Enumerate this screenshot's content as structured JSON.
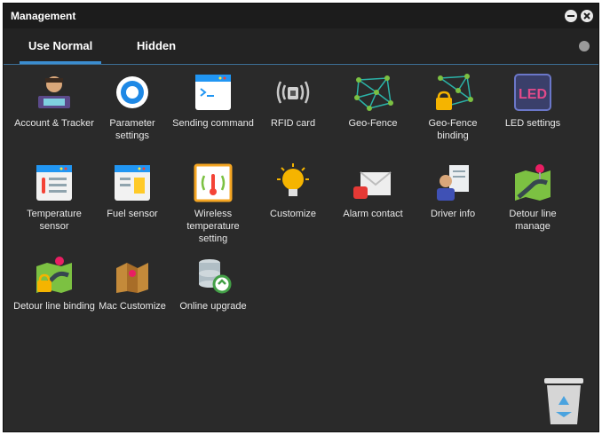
{
  "window": {
    "title": "Management"
  },
  "tabs": [
    {
      "label": "Use Normal",
      "active": true
    },
    {
      "label": "Hidden",
      "active": false
    }
  ],
  "items": [
    {
      "label": "Account & Tracker",
      "icon": "account-tracker-icon"
    },
    {
      "label": "Parameter settings",
      "icon": "gear-icon"
    },
    {
      "label": "Sending command",
      "icon": "terminal-icon"
    },
    {
      "label": "RFID card",
      "icon": "rfid-card-icon"
    },
    {
      "label": "Geo-Fence",
      "icon": "geo-fence-icon"
    },
    {
      "label": "Geo-Fence binding",
      "icon": "geo-fence-lock-icon"
    },
    {
      "label": "LED settings",
      "icon": "led-icon"
    },
    {
      "label": "Temperature sensor",
      "icon": "temperature-sensor-icon"
    },
    {
      "label": "Fuel sensor",
      "icon": "fuel-sensor-icon"
    },
    {
      "label": "Wireless temperature setting",
      "icon": "wireless-temperature-icon"
    },
    {
      "label": "Customize",
      "icon": "lightbulb-icon"
    },
    {
      "label": "Alarm contact",
      "icon": "alarm-mail-icon"
    },
    {
      "label": "Driver info",
      "icon": "driver-info-icon"
    },
    {
      "label": "Detour line manage",
      "icon": "detour-map-icon"
    },
    {
      "label": "Detour line binding",
      "icon": "detour-lock-icon"
    },
    {
      "label": "Mac Customize",
      "icon": "mac-customize-icon"
    },
    {
      "label": "Online upgrade",
      "icon": "database-upgrade-icon"
    }
  ],
  "colors": {
    "accent": "#3b8dd0",
    "background": "#2a2a2a",
    "titlebar": "#1c1c1c"
  }
}
